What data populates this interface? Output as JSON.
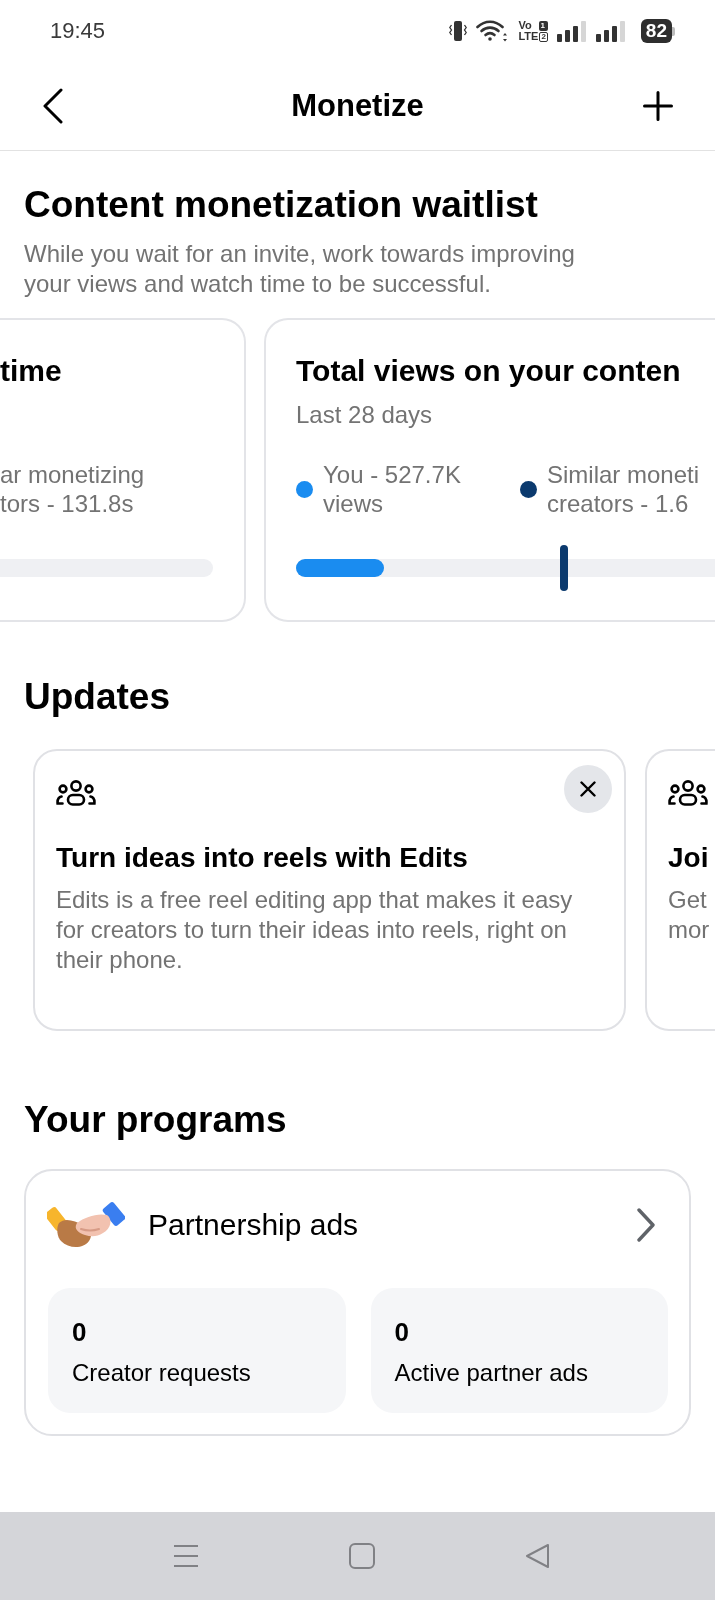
{
  "status_bar": {
    "time": "19:45",
    "network": {
      "top": "Vo",
      "top_badge": "1",
      "bottom": "LTE",
      "bottom_badge": "2"
    },
    "battery": "82"
  },
  "header": {
    "title": "Monetize"
  },
  "waitlist": {
    "title": "Content monetization waitlist",
    "subtitle": [
      "While you wait for an invite, work towards improving",
      "your views and watch time to be successful."
    ],
    "cards": [
      {
        "title": "time",
        "legend": [
          {
            "lines": [
              "ar monetizing",
              "tors - 131.8s"
            ]
          }
        ]
      },
      {
        "title": "Total views on your conten",
        "period": "Last 28 days",
        "legend": [
          {
            "lines": [
              "You - 527.7K",
              "views"
            ],
            "color": "#1a8cf0"
          },
          {
            "lines": [
              "Similar moneti",
              "creators - 1.6"
            ],
            "color": "#0b3a6e"
          }
        ],
        "marks": [
          {
            "kind": "fill",
            "level": 0.21
          },
          {
            "kind": "marker",
            "level": 0.64
          }
        ]
      }
    ]
  },
  "updates": {
    "title": "Updates",
    "items": [
      {
        "title": "Turn ideas into reels with Edits",
        "body": [
          "Edits is a free reel editing app that makes it easy",
          "for creators to turn their ideas into reels, right on",
          "their phone."
        ],
        "dismissible": true
      },
      {
        "title": "Joi",
        "body": [
          "Get",
          "mor"
        ],
        "dismissible": false
      }
    ]
  },
  "programs": {
    "title": "Your programs",
    "items": [
      {
        "name": "Partnership ads",
        "stats": [
          {
            "value": "0",
            "label": "Creator requests"
          },
          {
            "value": "0",
            "label": "Active partner ads"
          }
        ]
      }
    ]
  }
}
